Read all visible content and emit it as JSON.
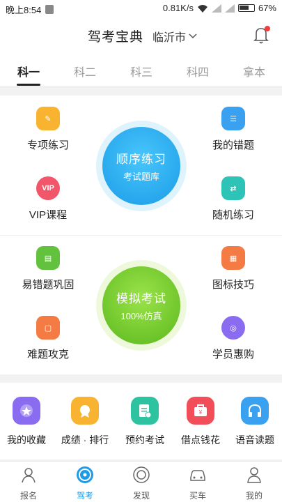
{
  "status_bar": {
    "time": "晚上8:54",
    "speed": "0.81K/s",
    "battery": "67%"
  },
  "header": {
    "title": "驾考宝典",
    "city": "临沂市"
  },
  "tabs": [
    "科一",
    "科二",
    "科三",
    "科四",
    "拿本"
  ],
  "grid": {
    "items": [
      {
        "label": "专项练习",
        "icon": "edit-icon",
        "color": "#f8b330"
      },
      {
        "label": "我的错题",
        "icon": "list-icon",
        "color": "#3aa0f0"
      },
      {
        "label": "VIP课程",
        "icon": "vip-icon",
        "color": "#f2566a"
      },
      {
        "label": "随机练习",
        "icon": "shuffle-icon",
        "color": "#2ec3b7"
      },
      {
        "label": "易错题巩固",
        "icon": "book-icon",
        "color": "#62c23e"
      },
      {
        "label": "图标技巧",
        "icon": "grid-icon",
        "color": "#f57b45"
      },
      {
        "label": "难题攻克",
        "icon": "doc-icon",
        "color": "#f57b45"
      },
      {
        "label": "学员惠购",
        "icon": "wheel-icon",
        "color": "#8a6cf0"
      }
    ],
    "circle_top": {
      "line1": "顺序练习",
      "line2": "考试题库"
    },
    "circle_bottom": {
      "line1": "模拟考试",
      "line2": "100%仿真"
    }
  },
  "bottom_row": [
    {
      "label": "我的收藏",
      "color": "#8a6cf0"
    },
    {
      "label": "成绩 · 排行",
      "color": "#f8b330"
    },
    {
      "label": "预约考试",
      "color": "#2ec3a0"
    },
    {
      "label": "借点钱花",
      "color": "#f24e5a"
    },
    {
      "label": "语音读题",
      "color": "#3aa0f0"
    }
  ],
  "nav": [
    {
      "label": "报名",
      "icon": "signup-icon"
    },
    {
      "label": "驾考",
      "icon": "steering-icon",
      "active": true
    },
    {
      "label": "发现",
      "icon": "discover-icon"
    },
    {
      "label": "买车",
      "icon": "car-icon"
    },
    {
      "label": "我的",
      "icon": "person-icon"
    }
  ]
}
